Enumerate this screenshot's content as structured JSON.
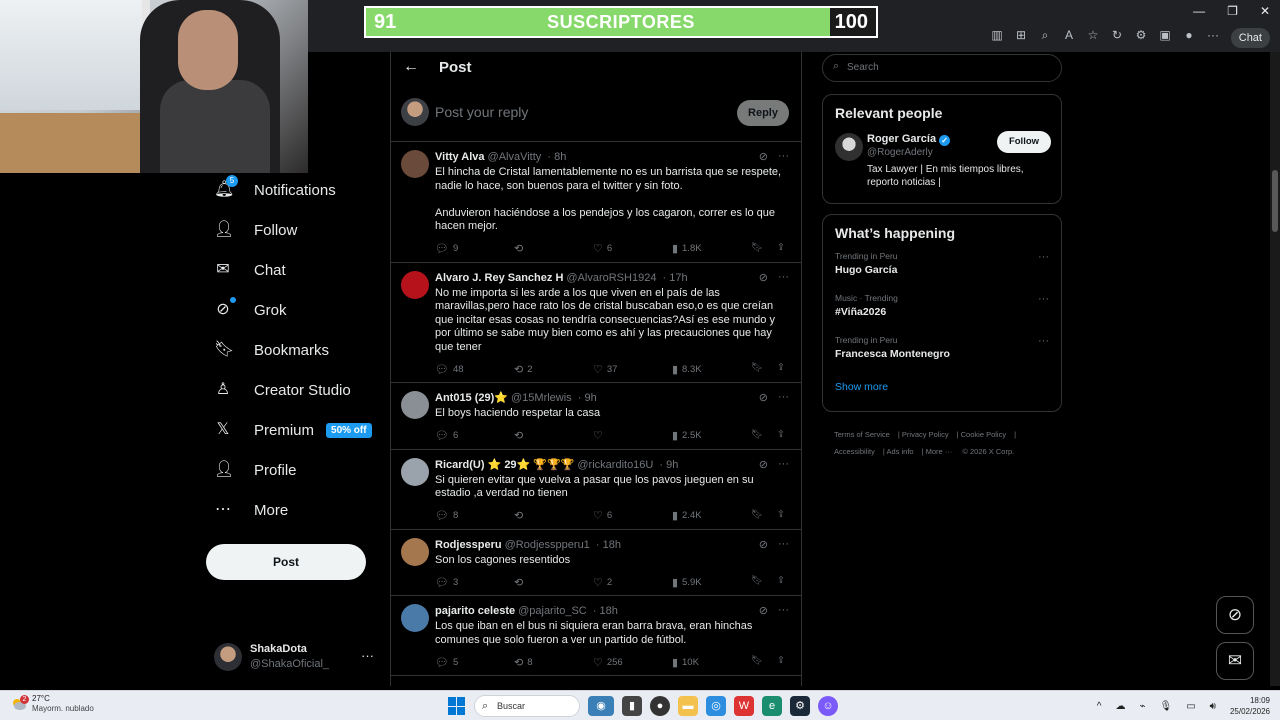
{
  "browser": {
    "chat_label": "Chat"
  },
  "sub_goal": {
    "current": "91",
    "label": "SUSCRIPTORES",
    "target": "100",
    "progress_fraction": 0.91
  },
  "nav": {
    "notifications_label": "Notifications",
    "notifications_badge": "5",
    "follow_label": "Follow",
    "chat_label": "Chat",
    "grok_label": "Grok",
    "bookmarks_label": "Bookmarks",
    "creator_studio_label": "Creator Studio",
    "premium_label": "Premium",
    "premium_promo": "50% off",
    "profile_label": "Profile",
    "more_label": "More",
    "post_button": "Post"
  },
  "account": {
    "name": "ShakaDota",
    "handle": "@ShakaOficial_",
    "more": "···"
  },
  "header": {
    "back": "←",
    "title": "Post"
  },
  "reply_box": {
    "placeholder": "Post your reply",
    "button": "Reply"
  },
  "tweets": [
    {
      "name": "Vitty Alva",
      "handle": "@AlvaVitty",
      "time": "· 8h",
      "text": "El hincha de Cristal lamentablemente no es un barrista que se respete, nadie lo hace, son buenos para el twitter y sin foto.\n\nAnduvieron haciéndose a los pendejos y los cagaron, correr es lo que hacen mejor.",
      "replies": "9",
      "reposts": "",
      "likes": "6",
      "views": "1.8K",
      "avatar_color": "#6a4a3a"
    },
    {
      "name": "Alvaro J. Rey Sanchez H",
      "handle": "@AlvaroRSH1924",
      "time": "· 17h",
      "text": "No me importa si les arde a los que viven en el país de las maravillas,pero hace rato los de cristal buscaban eso,o es que creían que incitar esas cosas no tendría consecuencias?Así es ese mundo y por último se sabe muy bien como es ahí y las precauciones que hay que tener",
      "replies": "48",
      "reposts": "2",
      "likes": "37",
      "views": "8.3K",
      "avatar_color": "#b5121b"
    },
    {
      "name": "Ant015 (29)⭐",
      "handle": "@15Mrlewis",
      "time": "· 9h",
      "text": "El boys haciendo respetar la casa",
      "replies": "6",
      "reposts": "",
      "likes": "",
      "views": "2.5K",
      "avatar_color": "#8a8f96"
    },
    {
      "name": "Ricard(U) ⭐ 29⭐ 🏆🏆🏆",
      "handle": "@rickardito16U",
      "time": "· 9h",
      "text": "Si quieren evitar que vuelva a pasar que los pavos jueguen en su estadio ,a verdad no tienen",
      "replies": "8",
      "reposts": "",
      "likes": "6",
      "views": "2.4K",
      "avatar_color": "#9aa3ab"
    },
    {
      "name": "Rodjessperu",
      "handle": "@Rodjesspperu1",
      "time": "· 18h",
      "text": "Son los cagones resentidos",
      "replies": "3",
      "reposts": "",
      "likes": "2",
      "views": "5.9K",
      "avatar_color": "#a5774f"
    },
    {
      "name": "pajarito celeste",
      "handle": "@pajarito_SC",
      "time": "· 18h",
      "text": "Los que iban en el bus ni siquiera eran barra brava, eran hinchas comunes que solo fueron a ver un partido de fútbol.",
      "replies": "5",
      "reposts": "8",
      "likes": "256",
      "views": "10K",
      "avatar_color": "#4a7aa8"
    }
  ],
  "search": {
    "placeholder": "Search"
  },
  "relevant": {
    "title": "Relevant people",
    "name": "Roger García",
    "handle": "@RogerAderly",
    "bio": "Tax Lawyer | En mis tiempos libres, reporto noticias |",
    "follow": "Follow"
  },
  "happening": {
    "title": "What’s happening",
    "trends": [
      {
        "context": "Trending in Peru",
        "topic": "Hugo García"
      },
      {
        "context": "Music · Trending",
        "topic": "#Viña2026"
      },
      {
        "context": "Trending in Peru",
        "topic": "Francesca Montenegro"
      }
    ],
    "show_more": "Show more"
  },
  "footer": {
    "terms": "Terms of Service",
    "privacy": "Privacy Policy",
    "cookie": "Cookie Policy",
    "accessibility": "Accessibility",
    "ads": "Ads info",
    "more": "More ···",
    "copyright": "© 2026 X Corp."
  },
  "taskbar": {
    "weather_badge": "2",
    "temperature": "27°C",
    "condition": "Mayorm. nublado",
    "search_label": "Buscar",
    "time": "18:09",
    "date": "25/02/2026"
  }
}
